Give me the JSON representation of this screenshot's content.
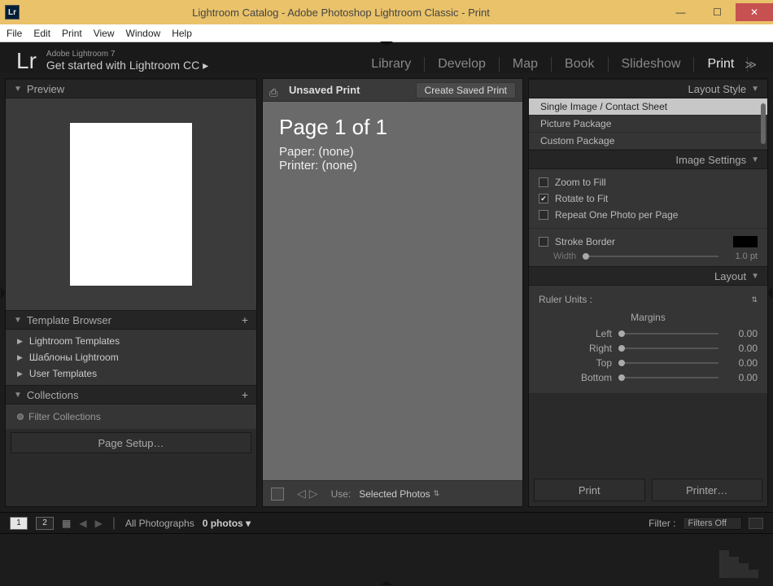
{
  "titlebar": {
    "icon_text": "Lr",
    "title": "Lightroom Catalog - Adobe Photoshop Lightroom Classic - Print"
  },
  "menubar": [
    "File",
    "Edit",
    "Print",
    "View",
    "Window",
    "Help"
  ],
  "brand": {
    "logo": "Lr",
    "line1": "Adobe Lightroom 7",
    "line2": "Get started with Lightroom CC ▸"
  },
  "modules": [
    "Library",
    "Develop",
    "Map",
    "Book",
    "Slideshow",
    "Print"
  ],
  "active_module": "Print",
  "left": {
    "preview": {
      "title": "Preview"
    },
    "template_browser": {
      "title": "Template Browser",
      "items": [
        "Lightroom Templates",
        "Шаблоны Lightroom",
        "User Templates"
      ]
    },
    "collections": {
      "title": "Collections",
      "filter_placeholder": "Filter Collections"
    },
    "page_setup": "Page Setup…"
  },
  "center": {
    "unsaved": "Unsaved Print",
    "create_btn": "Create Saved Print",
    "page_text": "Page 1 of 1",
    "paper_text": "Paper: (none)",
    "printer_text": "Printer: (none)",
    "use_label": "Use:",
    "use_value": "Selected Photos"
  },
  "right": {
    "layout_style": {
      "title": "Layout Style",
      "items": [
        "Single Image / Contact Sheet",
        "Picture Package",
        "Custom Package"
      ],
      "selected": "Single Image / Contact Sheet"
    },
    "image_settings": {
      "title": "Image Settings",
      "zoom_to_fill": "Zoom to Fill",
      "rotate_to_fit": "Rotate to Fit",
      "repeat_one": "Repeat One Photo per Page",
      "stroke_border": "Stroke Border",
      "width_label": "Width",
      "width_value": "1.0 pt"
    },
    "layout": {
      "title": "Layout",
      "ruler_units": "Ruler Units :",
      "margins_label": "Margins",
      "margins": {
        "Left": "0.00",
        "Right": "0.00",
        "Top": "0.00",
        "Bottom": "0.00"
      }
    },
    "print_btn": "Print",
    "printer_btn": "Printer…"
  },
  "filmstrip_bar": {
    "view1": "1",
    "view2": "2",
    "source": "All Photographs",
    "count": "0 photos",
    "filter_label": "Filter :",
    "filter_value": "Filters Off"
  }
}
